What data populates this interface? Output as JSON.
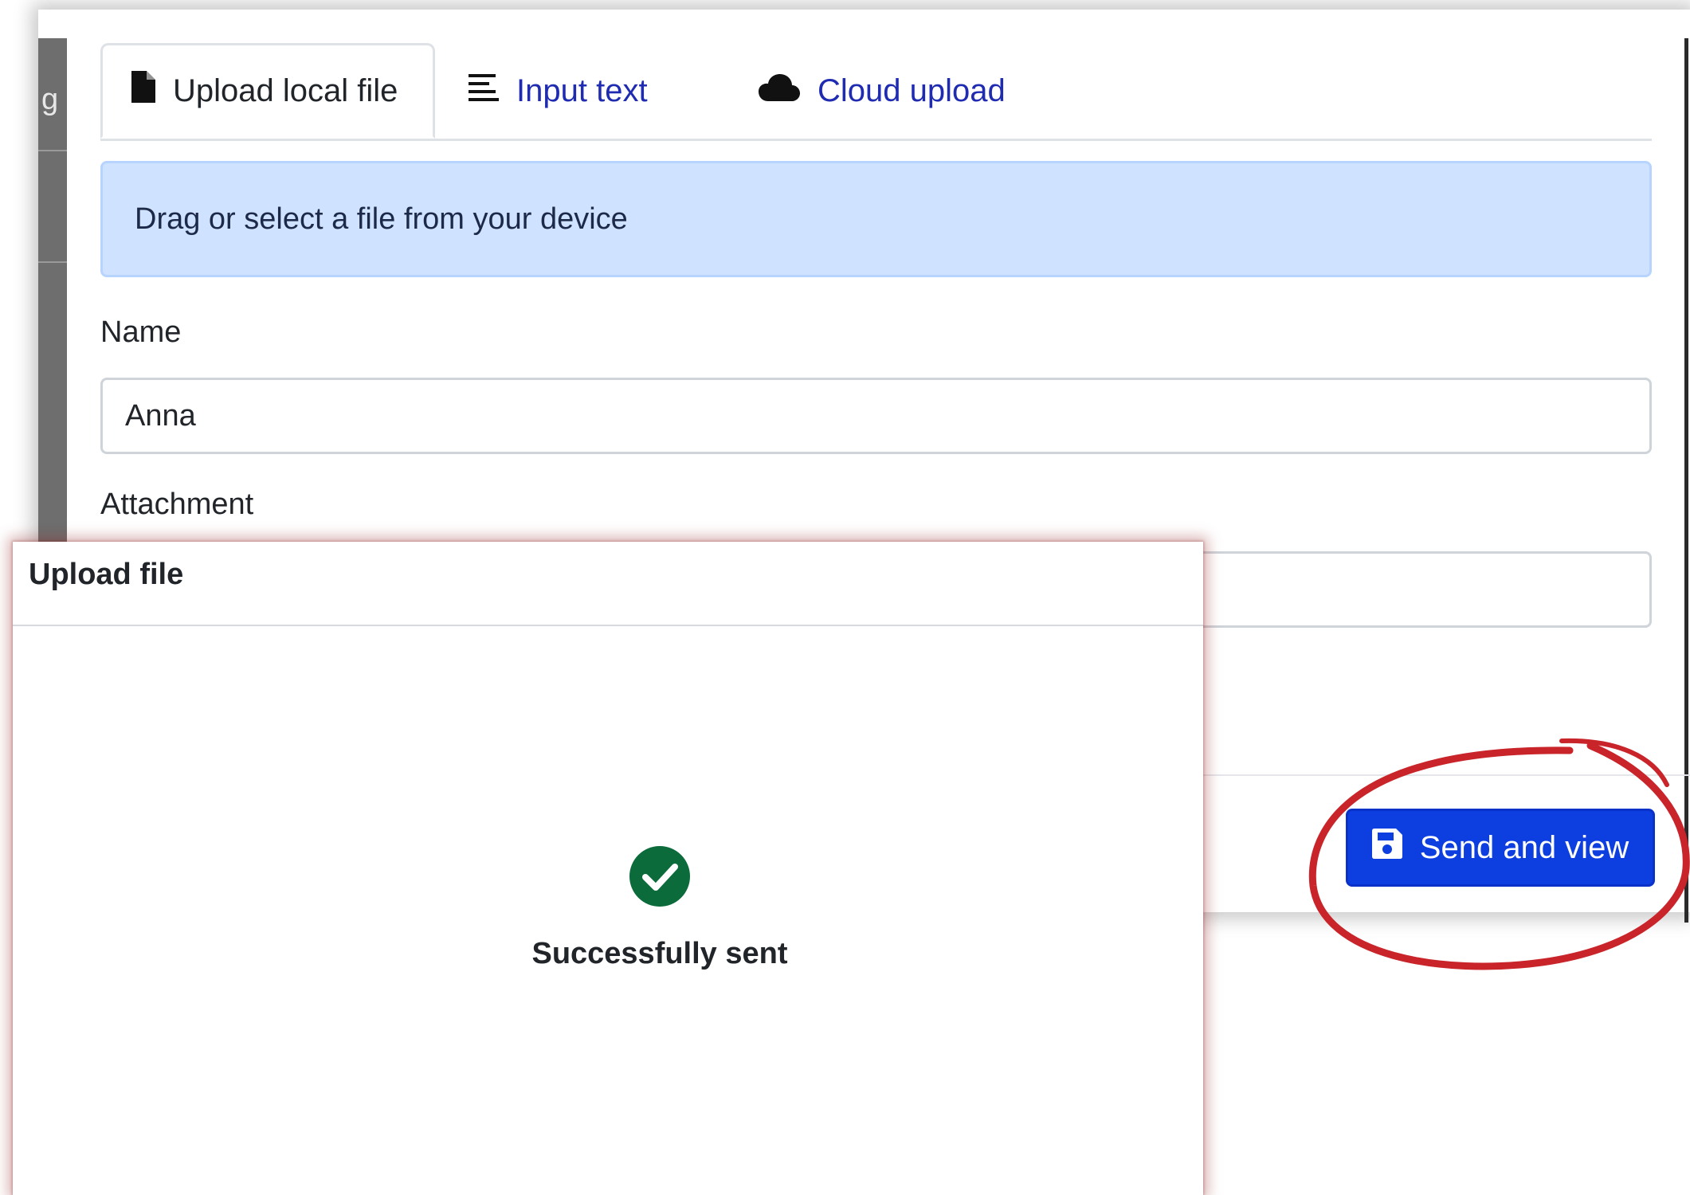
{
  "background_fragment": "g",
  "tabs": [
    {
      "label": "Upload local file",
      "icon": "file-icon",
      "active": true
    },
    {
      "label": "Input text",
      "icon": "text-lines-icon",
      "active": false
    },
    {
      "label": "Cloud upload",
      "icon": "cloud-icon",
      "active": false
    }
  ],
  "info_banner": "Drag or select a file from your device",
  "form": {
    "name_label": "Name",
    "name_value": "Anna",
    "attachment_label": "Attachment",
    "attachment_value": ""
  },
  "send_button": {
    "label": "Send and view",
    "icon": "save-icon"
  },
  "dialog": {
    "title": "Upload file",
    "status_icon": "check-circle-icon",
    "status_text": "Successfully sent"
  },
  "colors": {
    "link": "#1f2bb0",
    "banner_bg": "#cfe2ff",
    "button_bg": "#0d3ee0",
    "success": "#0b6b3a",
    "annotation": "#c8242a"
  }
}
